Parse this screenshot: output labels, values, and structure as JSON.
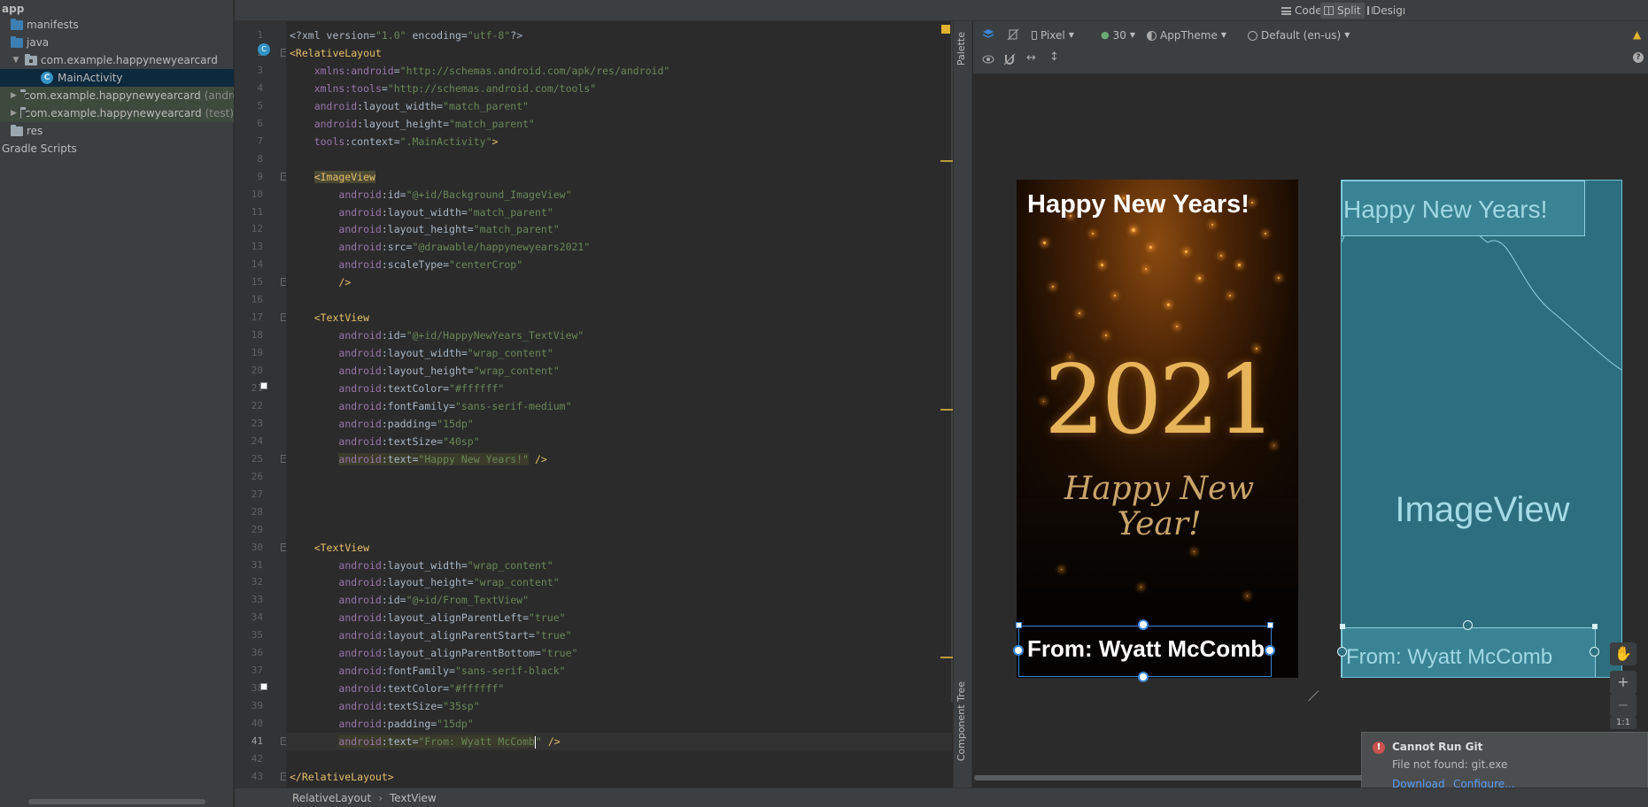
{
  "project_tree": [
    {
      "label": "app",
      "depth": 0,
      "icon": "none"
    },
    {
      "label": "manifests",
      "depth": 1,
      "icon": "folder-blue"
    },
    {
      "label": "java",
      "depth": 1,
      "icon": "folder-blue"
    },
    {
      "label": "com.example.happynewyearcard",
      "depth": 1,
      "icon": "package",
      "expanded": true
    },
    {
      "label": "MainActivity",
      "depth": 2,
      "icon": "class",
      "selected": true
    },
    {
      "label": "com.example.happynewyearcard",
      "suffix": "(androidTest)",
      "depth": 1,
      "icon": "package"
    },
    {
      "label": "com.example.happynewyearcard",
      "suffix": "(test)",
      "depth": 1,
      "icon": "package"
    },
    {
      "label": "res",
      "depth": 1,
      "icon": "folder-gray"
    },
    {
      "label": "Gradle Scripts",
      "depth": 0,
      "icon": "none"
    }
  ],
  "view_modes": {
    "code": "Code",
    "split": "Split",
    "design": "Design"
  },
  "design_toolbar": {
    "device": "Pixel",
    "api": "30",
    "theme": "AppTheme",
    "locale": "Default (en-us)"
  },
  "side_strip": {
    "palette": "Palette",
    "component_tree": "Component Tree"
  },
  "code_lines": [
    {
      "n": 1,
      "html": "<span class='pl'>&lt;?xml version=</span><span class='vl'>\"1.0\"</span><span class='pl'> encoding=</span><span class='vl'>\"utf-8\"</span><span class='pl'>?&gt;</span>"
    },
    {
      "n": 2,
      "html": "<span class='tg'>&lt;RelativeLayout</span>"
    },
    {
      "n": 3,
      "html": "    <span class='at'>xmlns:android</span><span class='pl'>=</span><span class='vl'>\"http://schemas.android.com/apk/res/android\"</span>"
    },
    {
      "n": 4,
      "html": "    <span class='at'>xmlns:tools</span><span class='pl'>=</span><span class='vl'>\"http://schemas.android.com/tools\"</span>"
    },
    {
      "n": 5,
      "html": "    <span class='ns'>android</span><span class='pl'>:layout_width=</span><span class='vl'>\"match_parent\"</span>"
    },
    {
      "n": 6,
      "html": "    <span class='ns'>android</span><span class='pl'>:layout_height=</span><span class='vl'>\"match_parent\"</span>"
    },
    {
      "n": 7,
      "html": "    <span class='ns'>tools</span><span class='pl'>:context=</span><span class='vl'>\".MainActivity\"</span><span class='tg'>&gt;</span>"
    },
    {
      "n": 8,
      "html": ""
    },
    {
      "n": 9,
      "html": "    <span class='tg hl2'>&lt;ImageView</span>"
    },
    {
      "n": 10,
      "html": "        <span class='ns'>android</span><span class='pl'>:id=</span><span class='vl'>\"@+id/Background_ImageView\"</span>"
    },
    {
      "n": 11,
      "html": "        <span class='ns'>android</span><span class='pl'>:layout_width=</span><span class='vl'>\"match_parent\"</span>"
    },
    {
      "n": 12,
      "html": "        <span class='ns'>android</span><span class='pl'>:layout_height=</span><span class='vl'>\"match_parent\"</span>"
    },
    {
      "n": 13,
      "html": "        <span class='ns'>android</span><span class='pl'>:src=</span><span class='vl'>\"@drawable/happynewyears2021\"</span>"
    },
    {
      "n": 14,
      "html": "        <span class='ns'>android</span><span class='pl'>:scaleType=</span><span class='vl'>\"centerCrop\"</span>"
    },
    {
      "n": 15,
      "html": "        <span class='tg'>/&gt;</span>"
    },
    {
      "n": 16,
      "html": ""
    },
    {
      "n": 17,
      "html": "    <span class='tg'>&lt;TextView</span>"
    },
    {
      "n": 18,
      "html": "        <span class='ns'>android</span><span class='pl'>:id=</span><span class='vl'>\"@+id/HappyNewYears_TextView\"</span>"
    },
    {
      "n": 19,
      "html": "        <span class='ns'>android</span><span class='pl'>:layout_width=</span><span class='vl'>\"wrap_content\"</span>"
    },
    {
      "n": 20,
      "html": "        <span class='ns'>android</span><span class='pl'>:layout_height=</span><span class='vl'>\"wrap_content\"</span>"
    },
    {
      "n": 21,
      "html": "        <span class='ns'>android</span><span class='pl'>:textColor=</span><span class='vl'>\"#ffffff\"</span>"
    },
    {
      "n": 22,
      "html": "        <span class='ns'>android</span><span class='pl'>:fontFamily=</span><span class='vl'>\"sans-serif-medium\"</span>"
    },
    {
      "n": 23,
      "html": "        <span class='ns'>android</span><span class='pl'>:padding=</span><span class='vl'>\"15dp\"</span>"
    },
    {
      "n": 24,
      "html": "        <span class='ns'>android</span><span class='pl'>:textSize=</span><span class='vl'>\"40sp\"</span>"
    },
    {
      "n": 25,
      "html": "        <span class='hl'><span class='ns'>android</span><span class='pl'>:text=</span><span class='vl'>\"Happy New Years!\"</span></span> <span class='tg'>/&gt;</span>"
    },
    {
      "n": 26,
      "html": ""
    },
    {
      "n": 27,
      "html": ""
    },
    {
      "n": 28,
      "html": ""
    },
    {
      "n": 29,
      "html": ""
    },
    {
      "n": 30,
      "html": "    <span class='tg'>&lt;TextView</span>"
    },
    {
      "n": 31,
      "html": "        <span class='ns'>android</span><span class='pl'>:layout_width=</span><span class='vl'>\"wrap_content\"</span>"
    },
    {
      "n": 32,
      "html": "        <span class='ns'>android</span><span class='pl'>:layout_height=</span><span class='vl'>\"wrap_content\"</span>"
    },
    {
      "n": 33,
      "html": "        <span class='ns'>android</span><span class='pl'>:id=</span><span class='vl'>\"@+id/From_TextView\"</span>"
    },
    {
      "n": 34,
      "html": "        <span class='ns'>android</span><span class='pl'>:layout_alignParentLeft=</span><span class='vl'>\"true\"</span>"
    },
    {
      "n": 35,
      "html": "        <span class='ns'>android</span><span class='pl'>:layout_alignParentStart=</span><span class='vl'>\"true\"</span>"
    },
    {
      "n": 36,
      "html": "        <span class='ns'>android</span><span class='pl'>:layout_alignParentBottom=</span><span class='vl'>\"true\"</span>"
    },
    {
      "n": 37,
      "html": "        <span class='ns'>android</span><span class='pl'>:fontFamily=</span><span class='vl'>\"sans-serif-black\"</span>"
    },
    {
      "n": 38,
      "html": "        <span class='ns'>android</span><span class='pl'>:textColor=</span><span class='vl'>\"#ffffff\"</span>"
    },
    {
      "n": 39,
      "html": "        <span class='ns'>android</span><span class='pl'>:textSize=</span><span class='vl'>\"35sp\"</span>"
    },
    {
      "n": 40,
      "html": "        <span class='ns'>android</span><span class='pl'>:padding=</span><span class='vl'>\"15dp\"</span>"
    },
    {
      "n": 41,
      "html": "        <span class='hl'><span class='ns'>android</span><span class='pl'>:text=</span><span class='vl'>\"From: Wyatt McComb</span></span><span class='caret'></span><span class='vl'>\"</span> <span class='tg'>/&gt;</span>",
      "current": true
    },
    {
      "n": 42,
      "html": ""
    },
    {
      "n": 43,
      "html": "<span class='tg'>&lt;/RelativeLayout&gt;</span>"
    }
  ],
  "design_preview": {
    "title_text": "Happy New Years!",
    "year_text": "2021",
    "script_text": "Happy New Year!",
    "from_text": "From: Wyatt McComb"
  },
  "blueprint": {
    "title_text": "Happy New Years!",
    "image_label": "ImageView",
    "from_text": "From: Wyatt McComb"
  },
  "notification": {
    "title": "Cannot Run Git",
    "body": "File not found: git.exe",
    "link_download": "Download",
    "link_configure": "Configure..."
  },
  "breadcrumb": [
    "RelativeLayout",
    "TextView"
  ],
  "zoom_label": "1:1",
  "colors": {
    "accent": "#3b86d6",
    "blueprint": "#2d6f7f",
    "warning": "#e0b12e",
    "error": "#c75450",
    "link": "#589df6"
  }
}
